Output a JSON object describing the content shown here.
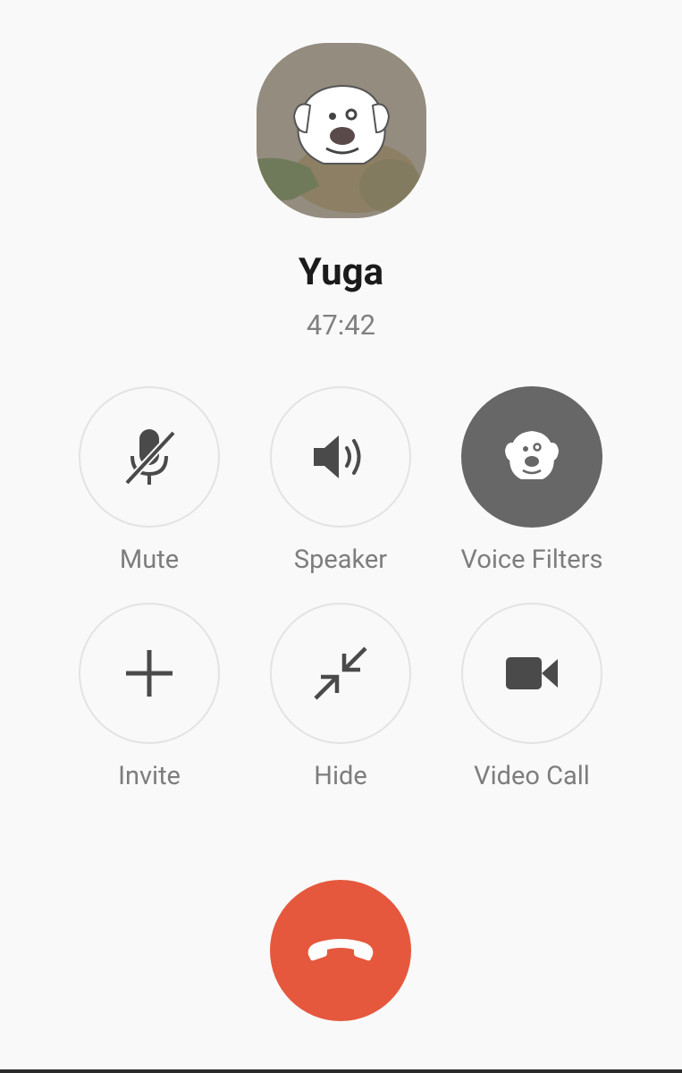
{
  "contact": {
    "name": "Yuga",
    "duration": "47:42"
  },
  "controls": [
    {
      "label": "Mute",
      "icon": "mic-off-icon",
      "active": false
    },
    {
      "label": "Speaker",
      "icon": "speaker-icon",
      "active": false
    },
    {
      "label": "Voice Filters",
      "icon": "dog-face-icon",
      "active": true
    },
    {
      "label": "Invite",
      "icon": "plus-icon",
      "active": false
    },
    {
      "label": "Hide",
      "icon": "minimize-arrows-icon",
      "active": false
    },
    {
      "label": "Video Call",
      "icon": "video-camera-icon",
      "active": false
    }
  ],
  "end_call": {
    "icon": "phone-hangup-icon"
  },
  "colors": {
    "background": "#f9f9f9",
    "end_call": "#e5583d",
    "active_control": "#676767",
    "icon": "#4a4a4a"
  }
}
